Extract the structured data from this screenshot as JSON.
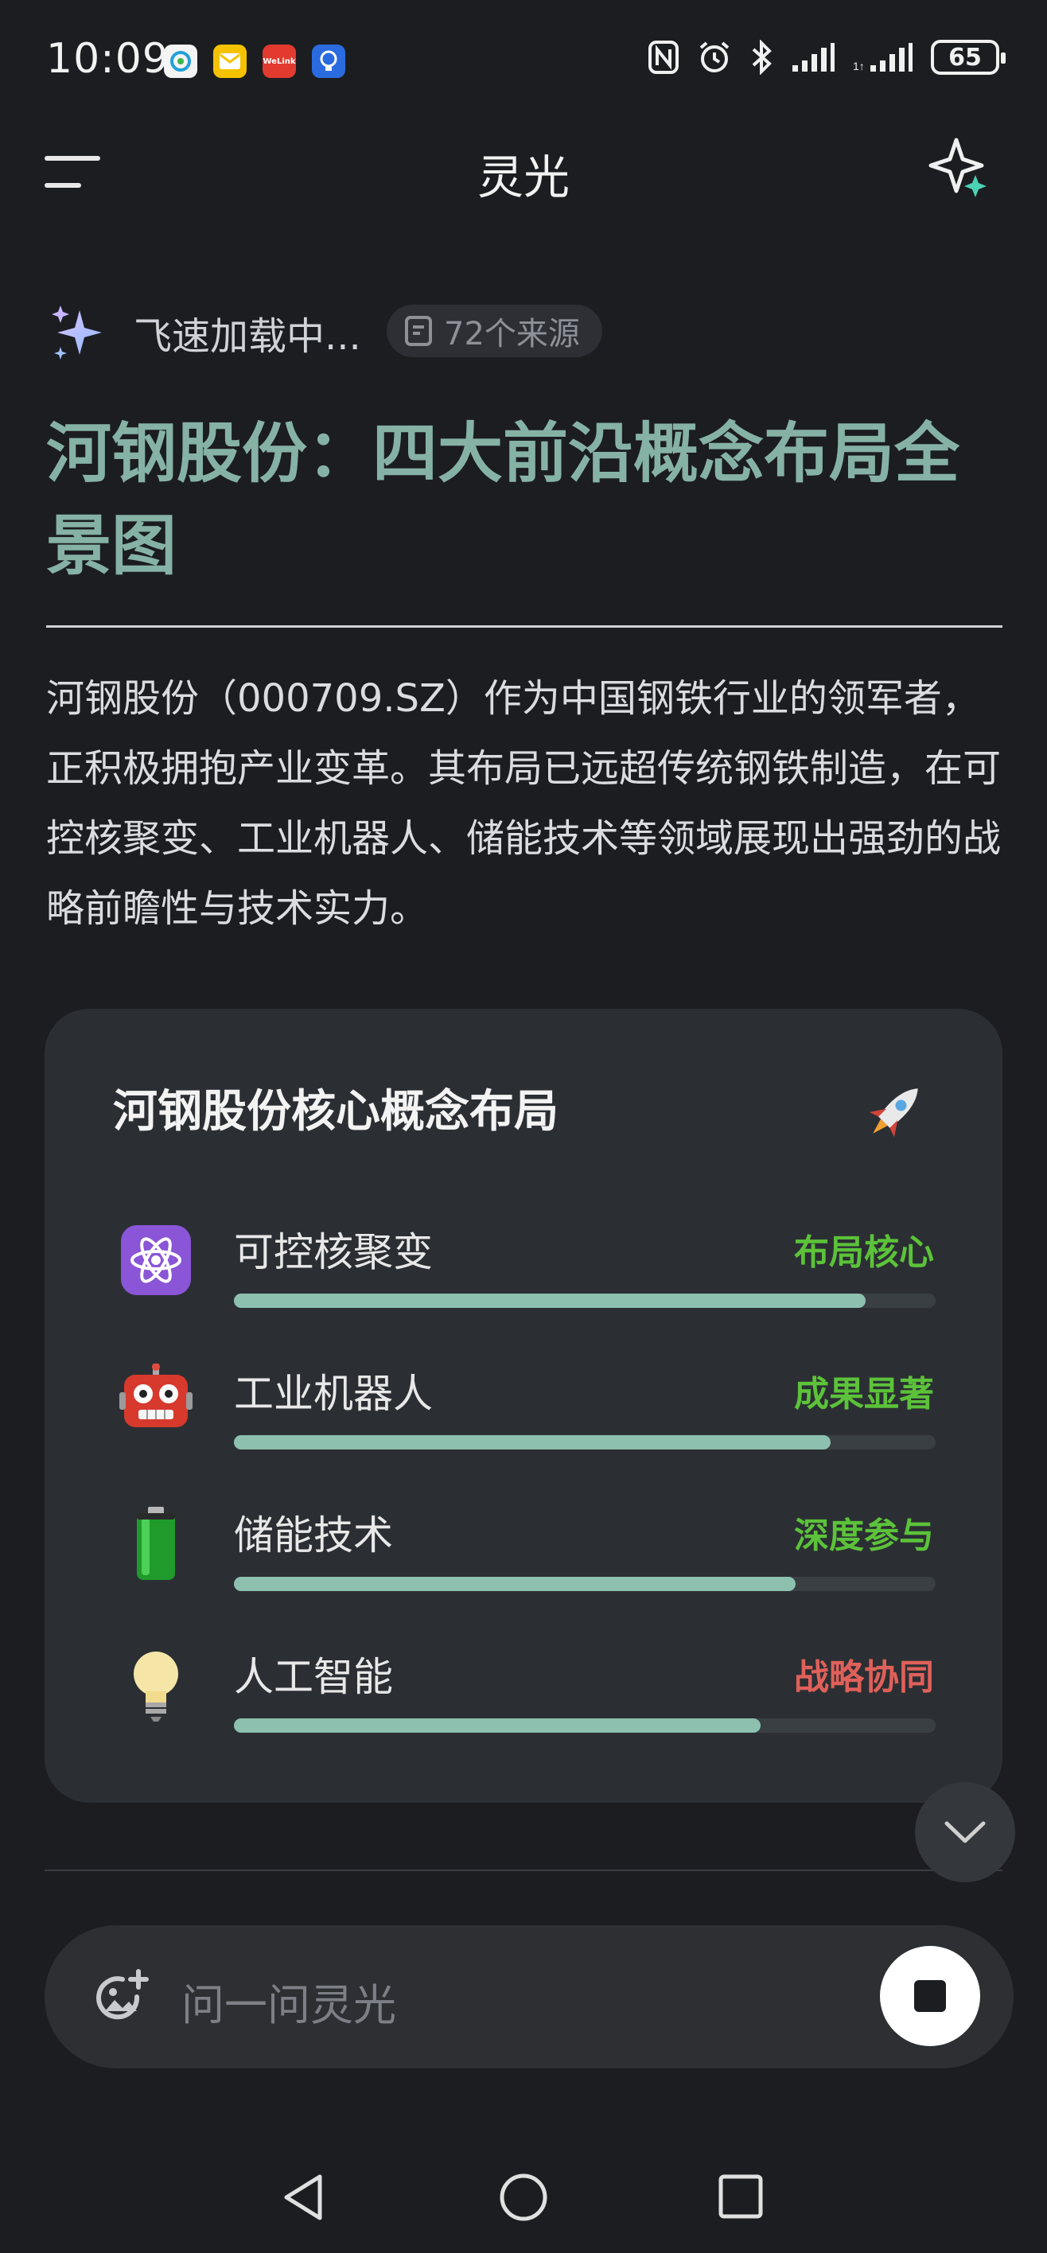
{
  "status_bar": {
    "time": "10:09",
    "notification_icons": [
      "china-mobile-icon",
      "mail-icon",
      "welink-icon",
      "bulb-app-icon"
    ],
    "welink_label": "WeLink",
    "system_icons": [
      "nfc-icon",
      "alarm-icon",
      "bluetooth-icon",
      "signal-icon",
      "signal-2-icon"
    ],
    "battery": "65"
  },
  "header": {
    "title": "灵光",
    "menu_icon": "menu-icon",
    "new_chat_icon": "sparkle-icon"
  },
  "response": {
    "loading_text": "飞速加载中...",
    "sources_chip": "72个来源",
    "headline": "河钢股份：四大前沿概念布局全景图",
    "paragraph": "河钢股份（000709.SZ）作为中国钢铁行业的领军者，正积极拥抱产业变革。其布局已远超传统钢铁制造，在可控核聚变、工业机器人、储能技术等领域展现出强劲的战略前瞻性与技术实力。"
  },
  "card": {
    "title": "河钢股份核心概念布局",
    "title_icon": "rocket-icon",
    "items": [
      {
        "label": "可控核聚变",
        "status": "布局核心",
        "status_color": "#5cc23a",
        "icon": "atom-icon",
        "progress": 0.9
      },
      {
        "label": "工业机器人",
        "status": "成果显著",
        "status_color": "#5cc23a",
        "icon": "robot-icon",
        "progress": 0.85
      },
      {
        "label": "储能技术",
        "status": "深度参与",
        "status_color": "#5cc23a",
        "icon": "battery-icon",
        "progress": 0.8
      },
      {
        "label": "人工智能",
        "status": "战略协同",
        "status_color": "#e0605a",
        "icon": "lightbulb-icon",
        "progress": 0.75
      }
    ]
  },
  "input": {
    "placeholder": "问一问灵光"
  },
  "colors": {
    "background": "#1c1d21",
    "accent_teal": "#86b2a6",
    "progress_fill": "#8dc0af",
    "status_green": "#5cc23a",
    "status_red": "#e0605a"
  }
}
